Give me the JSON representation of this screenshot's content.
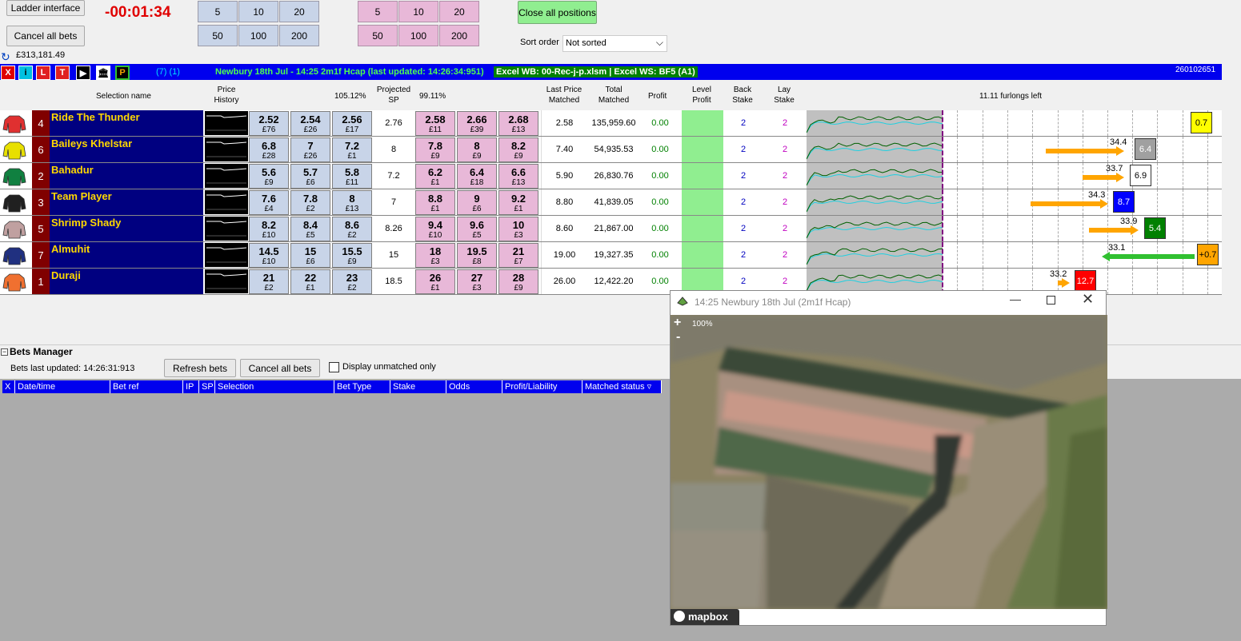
{
  "toolbar": {
    "ladder_btn": "Ladder interface",
    "cancel_btn": "Cancel all bets",
    "timer": "-00:01:34",
    "balance": "£313,181.49",
    "close_btn": "Close all positions",
    "sort_label": "Sort order",
    "sort_value": "Not sorted"
  },
  "stakes": {
    "back": [
      "5",
      "10",
      "20",
      "50",
      "100",
      "200"
    ],
    "lay": [
      "5",
      "10",
      "20",
      "50",
      "100",
      "200"
    ]
  },
  "bar": {
    "icons": [
      "X",
      "i",
      "L",
      "T",
      "▶",
      "🏛",
      "P"
    ],
    "counts": "(7) (1)",
    "title": "Newbury 18th Jul - 14:25 2m1f Hcap (last updated: 14:26:34:951)",
    "excel": "Excel WB: 00-Rec-j-p.xlsm | Excel WS: BF5 (A1)",
    "id": "260102651"
  },
  "headers": {
    "name": "Selection name",
    "price_history": "Price History",
    "back_pct": "105.12%",
    "proj_sp": "Projected SP",
    "lay_pct": "99.11%",
    "last_price": "Last Price Matched",
    "total": "Total Matched",
    "profit": "Profit",
    "level": "Level Profit",
    "back_stake": "Back Stake",
    "lay_stake": "Lay Stake",
    "furlongs": "11.11 furlongs left"
  },
  "colors": {
    "back": "#c8d4e8",
    "lay": "#e8b8d8",
    "name_bg": "#000080",
    "name_fg": "#ffd800",
    "num_bg": "#800000",
    "bar": "#0000ee",
    "level": "#90ee90"
  },
  "runners": [
    {
      "num": "4",
      "name": "Ride The Thunder",
      "silk": "#e03030",
      "back": [
        [
          "2.52",
          "£76"
        ],
        [
          "2.54",
          "£26"
        ],
        [
          "2.56",
          "£17"
        ]
      ],
      "sp": "2.76",
      "lay": [
        [
          "2.58",
          "£11"
        ],
        [
          "2.66",
          "£39"
        ],
        [
          "2.68",
          "£13"
        ]
      ],
      "last": "2.58",
      "total": "135,959.60",
      "profit": "0.00",
      "bs": "2",
      "ls": "2",
      "box": "0.7",
      "box_color": "#ffff00",
      "arrow_label": "",
      "arrow_color": ""
    },
    {
      "num": "6",
      "name": "Baileys Khelstar",
      "silk": "#e8e000",
      "back": [
        [
          "6.8",
          "£28"
        ],
        [
          "7",
          "£26"
        ],
        [
          "7.2",
          "£1"
        ]
      ],
      "sp": "8",
      "lay": [
        [
          "7.8",
          "£9"
        ],
        [
          "8",
          "£9"
        ],
        [
          "8.2",
          "£9"
        ]
      ],
      "last": "7.40",
      "total": "54,935.53",
      "profit": "0.00",
      "bs": "2",
      "ls": "2",
      "box": "6.4",
      "box_color": "#a0a0a0",
      "arrow_label": "34.4",
      "arrow_color": "#ffa500"
    },
    {
      "num": "2",
      "name": "Bahadur",
      "silk": "#108040",
      "back": [
        [
          "5.6",
          "£9"
        ],
        [
          "5.7",
          "£6"
        ],
        [
          "5.8",
          "£11"
        ]
      ],
      "sp": "7.2",
      "lay": [
        [
          "6.2",
          "£1"
        ],
        [
          "6.4",
          "£18"
        ],
        [
          "6.6",
          "£13"
        ]
      ],
      "last": "5.90",
      "total": "26,830.76",
      "profit": "0.00",
      "bs": "2",
      "ls": "2",
      "box": "6.9",
      "box_color": "#ffffff",
      "arrow_label": "33.7",
      "arrow_color": "#ffa500"
    },
    {
      "num": "3",
      "name": "Team Player",
      "silk": "#202020",
      "back": [
        [
          "7.6",
          "£4"
        ],
        [
          "7.8",
          "£2"
        ],
        [
          "8",
          "£13"
        ]
      ],
      "sp": "7",
      "lay": [
        [
          "8.8",
          "£1"
        ],
        [
          "9",
          "£6"
        ],
        [
          "9.2",
          "£1"
        ]
      ],
      "last": "8.80",
      "total": "41,839.05",
      "profit": "0.00",
      "bs": "2",
      "ls": "2",
      "box": "8.7",
      "box_color": "#0000ff",
      "arrow_label": "34.3",
      "arrow_color": "#ffa500"
    },
    {
      "num": "5",
      "name": "Shrimp Shady",
      "silk": "#c0a0a0",
      "back": [
        [
          "8.2",
          "£10"
        ],
        [
          "8.4",
          "£5"
        ],
        [
          "8.6",
          "£2"
        ]
      ],
      "sp": "8.26",
      "lay": [
        [
          "9.4",
          "£10"
        ],
        [
          "9.6",
          "£5"
        ],
        [
          "10",
          "£3"
        ]
      ],
      "last": "8.60",
      "total": "21,867.00",
      "profit": "0.00",
      "bs": "2",
      "ls": "2",
      "box": "5.4",
      "box_color": "#008000",
      "arrow_label": "33.9",
      "arrow_color": "#ffa500"
    },
    {
      "num": "7",
      "name": "Almuhit",
      "silk": "#203080",
      "back": [
        [
          "14.5",
          "£10"
        ],
        [
          "15",
          "£6"
        ],
        [
          "15.5",
          "£9"
        ]
      ],
      "sp": "15",
      "lay": [
        [
          "18",
          "£3"
        ],
        [
          "19.5",
          "£8"
        ],
        [
          "21",
          "£7"
        ]
      ],
      "last": "19.00",
      "total": "19,327.35",
      "profit": "0.00",
      "bs": "2",
      "ls": "2",
      "box": "+0.7",
      "box_color": "#ffa500",
      "arrow_label": "33.1",
      "arrow_color": "#30c030"
    },
    {
      "num": "1",
      "name": "Duraji",
      "silk": "#f07030",
      "back": [
        [
          "21",
          "£2"
        ],
        [
          "22",
          "£1"
        ],
        [
          "23",
          "£2"
        ]
      ],
      "sp": "18.5",
      "lay": [
        [
          "26",
          "£1"
        ],
        [
          "27",
          "£3"
        ],
        [
          "28",
          "£9"
        ]
      ],
      "last": "26.00",
      "total": "12,422.20",
      "profit": "0.00",
      "bs": "2",
      "ls": "2",
      "box": "12.7",
      "box_color": "#ff0000",
      "arrow_label": "33.2",
      "arrow_color": "#ffa500"
    }
  ],
  "bets": {
    "title": "Bets Manager",
    "updated": "Bets last updated: 14:26:31:913",
    "refresh": "Refresh bets",
    "cancel": "Cancel all bets",
    "unmatched": "Display unmatched only",
    "columns": [
      "X",
      "Date/time",
      "Bet ref",
      "IP",
      "SP",
      "Selection",
      "Bet Type",
      "Stake",
      "Odds",
      "Profit/Liability",
      "Matched status ▿"
    ]
  },
  "map": {
    "title": "14:25 Newbury 18th Jul (2m1f Hcap)",
    "zoom": "100%",
    "logo": "mapbox",
    "plus": "+",
    "minus": "-"
  }
}
